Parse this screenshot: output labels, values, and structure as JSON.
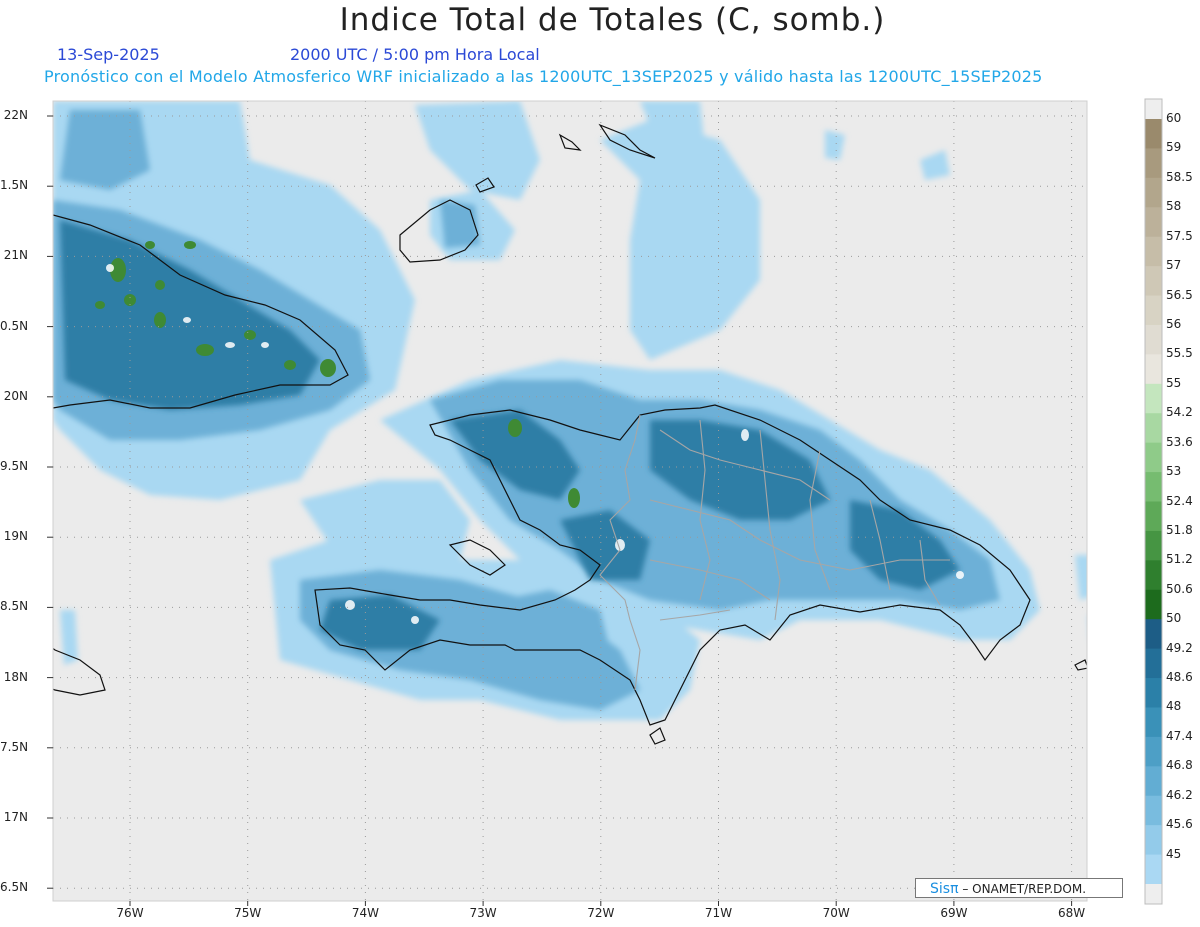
{
  "header": {
    "title": "Indice Total de Totales (C, somb.)",
    "date": "13-Sep-2025",
    "time": "2000 UTC / 5:00 pm Hora Local",
    "subtitle": "Pronóstico con el Modelo Atmosferico WRF inicializado a las 1200UTC_13SEP2025 y válido hasta las  1200UTC_15SEP2025"
  },
  "map": {
    "lat_labels": [
      "22N",
      "1.5N",
      "21N",
      "0.5N",
      "20N",
      "9.5N",
      "19N",
      "8.5N",
      "18N",
      "7.5N",
      "17N",
      "6.5N"
    ],
    "lon_labels": [
      "76W",
      "75W",
      "74W",
      "73W",
      "72W",
      "71W",
      "70W",
      "69W",
      "68W"
    ],
    "background_color": "#ebebeb",
    "coastline_color": "#111111",
    "border_color": "#a6a6a6"
  },
  "colorbar": {
    "labels": [
      "60",
      "59",
      "58.5",
      "58",
      "57.5",
      "57",
      "56.5",
      "56",
      "55.5",
      "55",
      "54.2",
      "53.6",
      "53",
      "52.4",
      "51.8",
      "51.2",
      "50.6",
      "50",
      "49.2",
      "48.6",
      "48",
      "47.4",
      "46.8",
      "46.2",
      "45.6",
      "45"
    ],
    "colors": [
      "#9a8a6c",
      "#a89a7e",
      "#b2a68c",
      "#bcb19a",
      "#c6bda8",
      "#cfc8b6",
      "#d8d3c4",
      "#e0dcd2",
      "#e9e6de",
      "#c4e6be",
      "#a8d8a2",
      "#8fcb89",
      "#76bc70",
      "#5ea958",
      "#469543",
      "#2f7f2e",
      "#1d6b1d",
      "#1d5d86",
      "#236f98",
      "#2b80a8",
      "#3a91b8",
      "#4d9fc6",
      "#62add3",
      "#79bcdf",
      "#93cbea",
      "#aad8f3"
    ]
  },
  "credit": {
    "sis": "Sis",
    "pi": "π",
    "text": " – ONAMET/REP.DOM."
  }
}
